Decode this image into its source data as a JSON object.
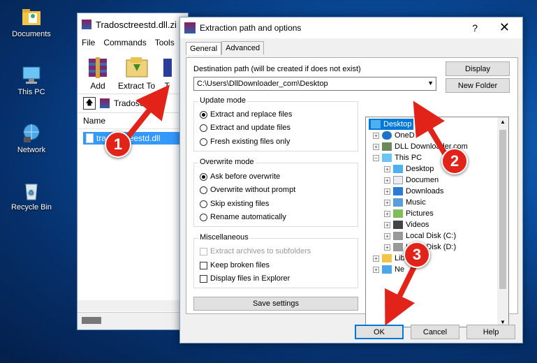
{
  "desktop": {
    "icons": [
      {
        "label": "Documents"
      },
      {
        "label": "This PC"
      },
      {
        "label": "Network"
      },
      {
        "label": "Recycle Bin"
      }
    ]
  },
  "rar": {
    "title": "Tradosctreestd.dll.zi",
    "menu": [
      "File",
      "Commands",
      "Tools"
    ],
    "toolbar": {
      "add": "Add",
      "extract": "Extract To",
      "third": "T"
    },
    "address": "Tradosctr",
    "column": "Name",
    "file": "tradosctreestd.dll"
  },
  "dialog": {
    "title": "Extraction path and options",
    "help": "?",
    "close": "✕",
    "tabs": [
      "General",
      "Advanced"
    ],
    "dest_label": "Destination path (will be created if does not exist)",
    "dest_value": "C:\\Users\\DllDownloader_com\\Desktop",
    "display_btn": "Display",
    "new_folder_btn": "New Folder",
    "update_mode": {
      "title": "Update mode",
      "options": [
        "Extract and replace files",
        "Extract and update files",
        "Fresh existing files only"
      ],
      "selected": 0
    },
    "overwrite_mode": {
      "title": "Overwrite mode",
      "options": [
        "Ask before overwrite",
        "Overwrite without prompt",
        "Skip existing files",
        "Rename automatically"
      ],
      "selected": 0
    },
    "misc": {
      "title": "Miscellaneous",
      "options": [
        "Extract archives to subfolders",
        "Keep broken files",
        "Display files in Explorer"
      ]
    },
    "save_settings": "Save settings",
    "tree": [
      "Desktop",
      "OneD",
      "DLL Downloader.com",
      "This PC",
      "Desktop",
      "Documen",
      "Downloads",
      "Music",
      "Pictures",
      "Videos",
      "Local Disk (C:)",
      "Local Disk (D:)",
      "Libraries",
      "Ne"
    ],
    "ok": "OK",
    "cancel": "Cancel",
    "help_btn": "Help"
  },
  "annotations": [
    "1",
    "2",
    "3"
  ],
  "colors": {
    "accent": "#0078d7",
    "annotation": "#e2231a"
  }
}
